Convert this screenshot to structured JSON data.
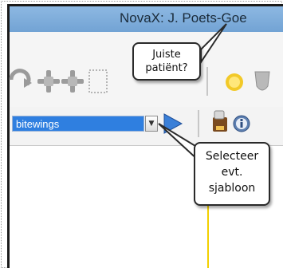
{
  "window": {
    "title": "NovaX: J. Poets-Goe"
  },
  "template_select": {
    "selected": "bitewings"
  },
  "callouts": {
    "patient_check": [
      "Juiste",
      "patiënt?"
    ],
    "select_template": [
      "Selecteer",
      "evt.",
      "sjabloon"
    ]
  },
  "colors": {
    "titlebar": "#7eaedc",
    "selection": "#2f7fe0",
    "divider": "#f2d000",
    "play_arrow": "#3a7fd8"
  }
}
